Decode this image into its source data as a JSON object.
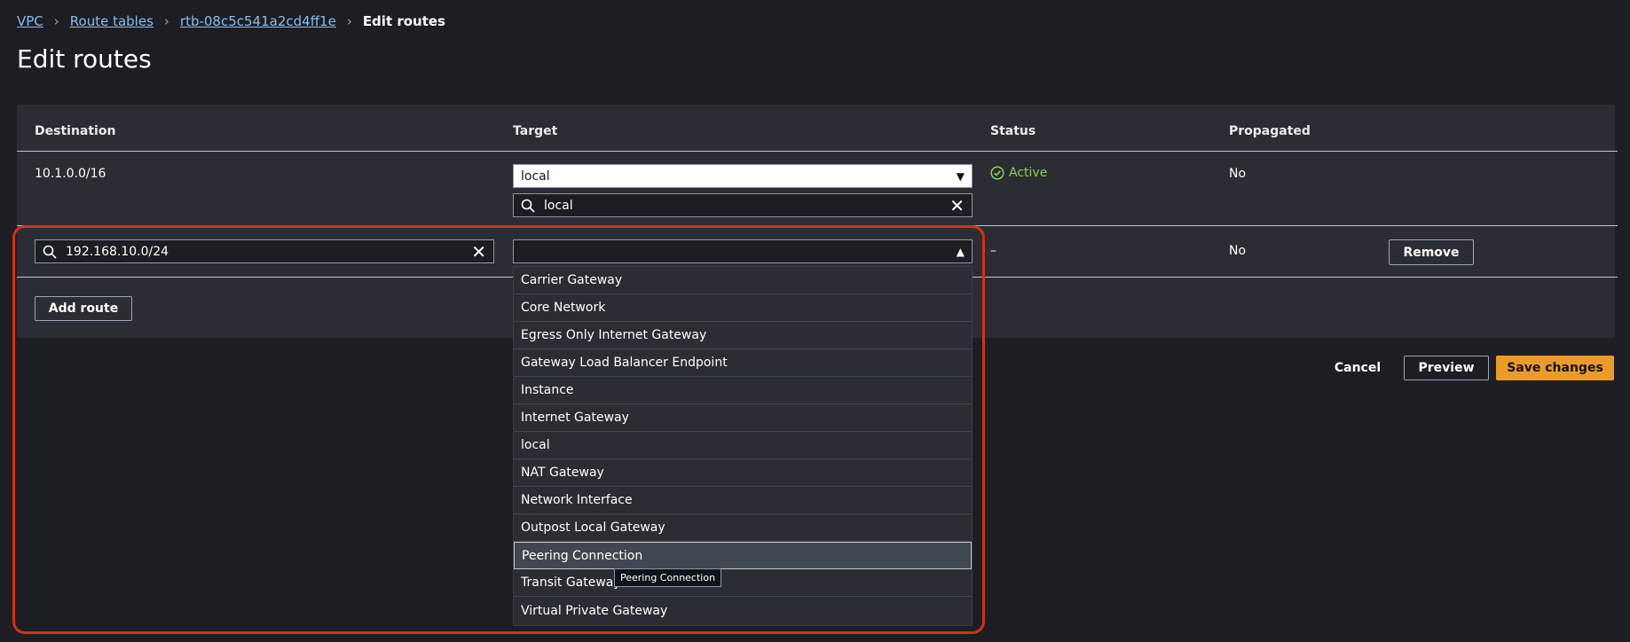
{
  "breadcrumb": {
    "vpc": "VPC",
    "route_tables": "Route tables",
    "rtb_id": "rtb-08c5c541a2cd4ff1e",
    "current": "Edit routes"
  },
  "page_title": "Edit routes",
  "table": {
    "headers": [
      "Destination",
      "Target",
      "Status",
      "Propagated"
    ],
    "rows": [
      {
        "destination": "10.1.0.0/16",
        "target": "local",
        "target_filter": "local",
        "status": "Active",
        "propagated": "No"
      },
      {
        "destination": "192.168.10.0/24",
        "target": "",
        "status": "–",
        "propagated": "No",
        "remove_label": "Remove"
      }
    ],
    "add_route_label": "Add route"
  },
  "dropdown": {
    "options": [
      "Carrier Gateway",
      "Core Network",
      "Egress Only Internet Gateway",
      "Gateway Load Balancer Endpoint",
      "Instance",
      "Internet Gateway",
      "local",
      "NAT Gateway",
      "Network Interface",
      "Outpost Local Gateway",
      "Peering Connection",
      "Transit Gateway",
      "Virtual Private Gateway"
    ],
    "highlighted": "Peering Connection",
    "tooltip": "Peering Connection"
  },
  "actions": {
    "cancel": "Cancel",
    "preview": "Preview",
    "save": "Save changes"
  },
  "colors": {
    "background": "#1c1e23",
    "panel": "#2a2d33",
    "link": "#89bdf0",
    "active_status": "#8ccf54",
    "primary_button": "#ec9b2b",
    "annotation_box": "#d13212"
  }
}
